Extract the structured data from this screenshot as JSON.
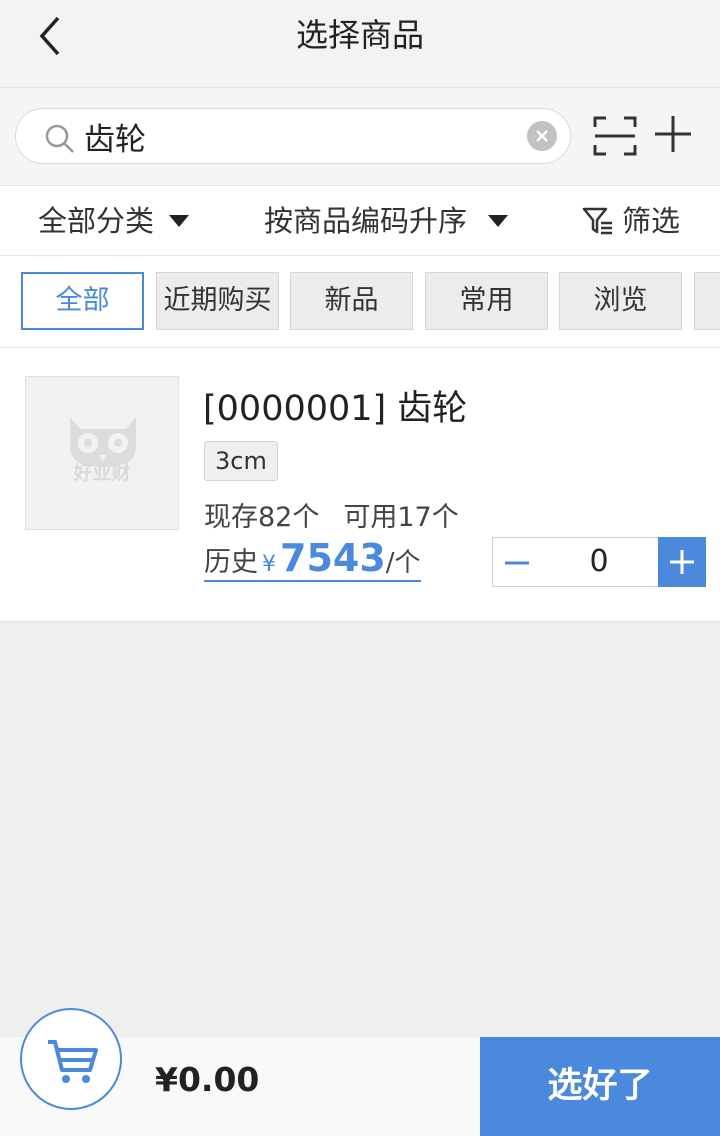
{
  "header": {
    "title": "选择商品"
  },
  "search": {
    "value": "齿轮"
  },
  "filters": {
    "category_label": "全部分类",
    "sort_label": "按商品编码升序",
    "filter_label": "筛选"
  },
  "tabs": [
    {
      "label": "全部",
      "active": true
    },
    {
      "label": "近期购买"
    },
    {
      "label": "新品"
    },
    {
      "label": "常用"
    },
    {
      "label": "浏览"
    }
  ],
  "product": {
    "name": "[0000001] 齿轮",
    "spec": "3cm",
    "stock_text": "现存82个",
    "available_text": "可用17个",
    "history_label": "历史",
    "currency": "¥",
    "price": "7543",
    "unit": "/个",
    "quantity": "0",
    "placeholder_logo": "好业财"
  },
  "bottom": {
    "total": "¥0.00",
    "confirm_label": "选好了"
  },
  "colors": {
    "accent": "#4a89dc"
  }
}
